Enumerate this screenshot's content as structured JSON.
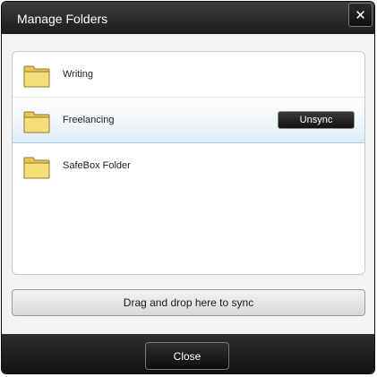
{
  "window": {
    "title": "Manage Folders",
    "close_glyph": "✕",
    "close_icon": "close-icon"
  },
  "folders": [
    {
      "label": "Writing",
      "icon": "folder-icon",
      "selected": false
    },
    {
      "label": "Freelancing",
      "icon": "folder-icon",
      "selected": true,
      "action_label": "Unsync"
    },
    {
      "label": "SafeBox Folder",
      "icon": "folder-icon",
      "selected": false
    }
  ],
  "dropzone": {
    "label": "Drag and drop here to sync"
  },
  "footer": {
    "close_label": "Close"
  },
  "colors": {
    "title_bar": "#2b2b2b",
    "selection": "#d9ebf7",
    "folder_fill": "#f3d96a",
    "folder_outline": "#8c7a34"
  }
}
